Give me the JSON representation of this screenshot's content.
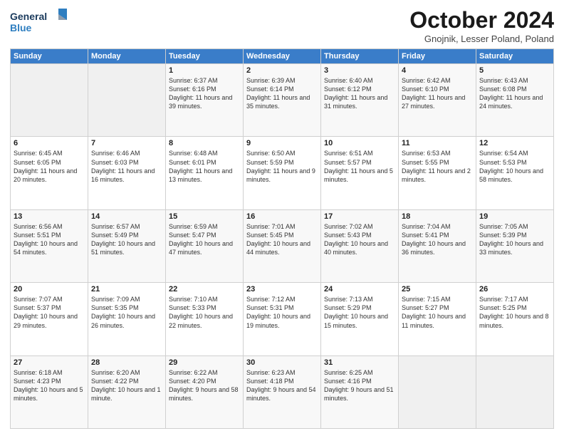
{
  "header": {
    "logo_line1": "General",
    "logo_line2": "Blue",
    "title": "October 2024",
    "subtitle": "Gnojnik, Lesser Poland, Poland"
  },
  "days_of_week": [
    "Sunday",
    "Monday",
    "Tuesday",
    "Wednesday",
    "Thursday",
    "Friday",
    "Saturday"
  ],
  "weeks": [
    [
      {
        "day": "",
        "sunrise": "",
        "sunset": "",
        "daylight": ""
      },
      {
        "day": "",
        "sunrise": "",
        "sunset": "",
        "daylight": ""
      },
      {
        "day": "1",
        "sunrise": "Sunrise: 6:37 AM",
        "sunset": "Sunset: 6:16 PM",
        "daylight": "Daylight: 11 hours and 39 minutes."
      },
      {
        "day": "2",
        "sunrise": "Sunrise: 6:39 AM",
        "sunset": "Sunset: 6:14 PM",
        "daylight": "Daylight: 11 hours and 35 minutes."
      },
      {
        "day": "3",
        "sunrise": "Sunrise: 6:40 AM",
        "sunset": "Sunset: 6:12 PM",
        "daylight": "Daylight: 11 hours and 31 minutes."
      },
      {
        "day": "4",
        "sunrise": "Sunrise: 6:42 AM",
        "sunset": "Sunset: 6:10 PM",
        "daylight": "Daylight: 11 hours and 27 minutes."
      },
      {
        "day": "5",
        "sunrise": "Sunrise: 6:43 AM",
        "sunset": "Sunset: 6:08 PM",
        "daylight": "Daylight: 11 hours and 24 minutes."
      }
    ],
    [
      {
        "day": "6",
        "sunrise": "Sunrise: 6:45 AM",
        "sunset": "Sunset: 6:05 PM",
        "daylight": "Daylight: 11 hours and 20 minutes."
      },
      {
        "day": "7",
        "sunrise": "Sunrise: 6:46 AM",
        "sunset": "Sunset: 6:03 PM",
        "daylight": "Daylight: 11 hours and 16 minutes."
      },
      {
        "day": "8",
        "sunrise": "Sunrise: 6:48 AM",
        "sunset": "Sunset: 6:01 PM",
        "daylight": "Daylight: 11 hours and 13 minutes."
      },
      {
        "day": "9",
        "sunrise": "Sunrise: 6:50 AM",
        "sunset": "Sunset: 5:59 PM",
        "daylight": "Daylight: 11 hours and 9 minutes."
      },
      {
        "day": "10",
        "sunrise": "Sunrise: 6:51 AM",
        "sunset": "Sunset: 5:57 PM",
        "daylight": "Daylight: 11 hours and 5 minutes."
      },
      {
        "day": "11",
        "sunrise": "Sunrise: 6:53 AM",
        "sunset": "Sunset: 5:55 PM",
        "daylight": "Daylight: 11 hours and 2 minutes."
      },
      {
        "day": "12",
        "sunrise": "Sunrise: 6:54 AM",
        "sunset": "Sunset: 5:53 PM",
        "daylight": "Daylight: 10 hours and 58 minutes."
      }
    ],
    [
      {
        "day": "13",
        "sunrise": "Sunrise: 6:56 AM",
        "sunset": "Sunset: 5:51 PM",
        "daylight": "Daylight: 10 hours and 54 minutes."
      },
      {
        "day": "14",
        "sunrise": "Sunrise: 6:57 AM",
        "sunset": "Sunset: 5:49 PM",
        "daylight": "Daylight: 10 hours and 51 minutes."
      },
      {
        "day": "15",
        "sunrise": "Sunrise: 6:59 AM",
        "sunset": "Sunset: 5:47 PM",
        "daylight": "Daylight: 10 hours and 47 minutes."
      },
      {
        "day": "16",
        "sunrise": "Sunrise: 7:01 AM",
        "sunset": "Sunset: 5:45 PM",
        "daylight": "Daylight: 10 hours and 44 minutes."
      },
      {
        "day": "17",
        "sunrise": "Sunrise: 7:02 AM",
        "sunset": "Sunset: 5:43 PM",
        "daylight": "Daylight: 10 hours and 40 minutes."
      },
      {
        "day": "18",
        "sunrise": "Sunrise: 7:04 AM",
        "sunset": "Sunset: 5:41 PM",
        "daylight": "Daylight: 10 hours and 36 minutes."
      },
      {
        "day": "19",
        "sunrise": "Sunrise: 7:05 AM",
        "sunset": "Sunset: 5:39 PM",
        "daylight": "Daylight: 10 hours and 33 minutes."
      }
    ],
    [
      {
        "day": "20",
        "sunrise": "Sunrise: 7:07 AM",
        "sunset": "Sunset: 5:37 PM",
        "daylight": "Daylight: 10 hours and 29 minutes."
      },
      {
        "day": "21",
        "sunrise": "Sunrise: 7:09 AM",
        "sunset": "Sunset: 5:35 PM",
        "daylight": "Daylight: 10 hours and 26 minutes."
      },
      {
        "day": "22",
        "sunrise": "Sunrise: 7:10 AM",
        "sunset": "Sunset: 5:33 PM",
        "daylight": "Daylight: 10 hours and 22 minutes."
      },
      {
        "day": "23",
        "sunrise": "Sunrise: 7:12 AM",
        "sunset": "Sunset: 5:31 PM",
        "daylight": "Daylight: 10 hours and 19 minutes."
      },
      {
        "day": "24",
        "sunrise": "Sunrise: 7:13 AM",
        "sunset": "Sunset: 5:29 PM",
        "daylight": "Daylight: 10 hours and 15 minutes."
      },
      {
        "day": "25",
        "sunrise": "Sunrise: 7:15 AM",
        "sunset": "Sunset: 5:27 PM",
        "daylight": "Daylight: 10 hours and 11 minutes."
      },
      {
        "day": "26",
        "sunrise": "Sunrise: 7:17 AM",
        "sunset": "Sunset: 5:25 PM",
        "daylight": "Daylight: 10 hours and 8 minutes."
      }
    ],
    [
      {
        "day": "27",
        "sunrise": "Sunrise: 6:18 AM",
        "sunset": "Sunset: 4:23 PM",
        "daylight": "Daylight: 10 hours and 5 minutes."
      },
      {
        "day": "28",
        "sunrise": "Sunrise: 6:20 AM",
        "sunset": "Sunset: 4:22 PM",
        "daylight": "Daylight: 10 hours and 1 minute."
      },
      {
        "day": "29",
        "sunrise": "Sunrise: 6:22 AM",
        "sunset": "Sunset: 4:20 PM",
        "daylight": "Daylight: 9 hours and 58 minutes."
      },
      {
        "day": "30",
        "sunrise": "Sunrise: 6:23 AM",
        "sunset": "Sunset: 4:18 PM",
        "daylight": "Daylight: 9 hours and 54 minutes."
      },
      {
        "day": "31",
        "sunrise": "Sunrise: 6:25 AM",
        "sunset": "Sunset: 4:16 PM",
        "daylight": "Daylight: 9 hours and 51 minutes."
      },
      {
        "day": "",
        "sunrise": "",
        "sunset": "",
        "daylight": ""
      },
      {
        "day": "",
        "sunrise": "",
        "sunset": "",
        "daylight": ""
      }
    ]
  ]
}
